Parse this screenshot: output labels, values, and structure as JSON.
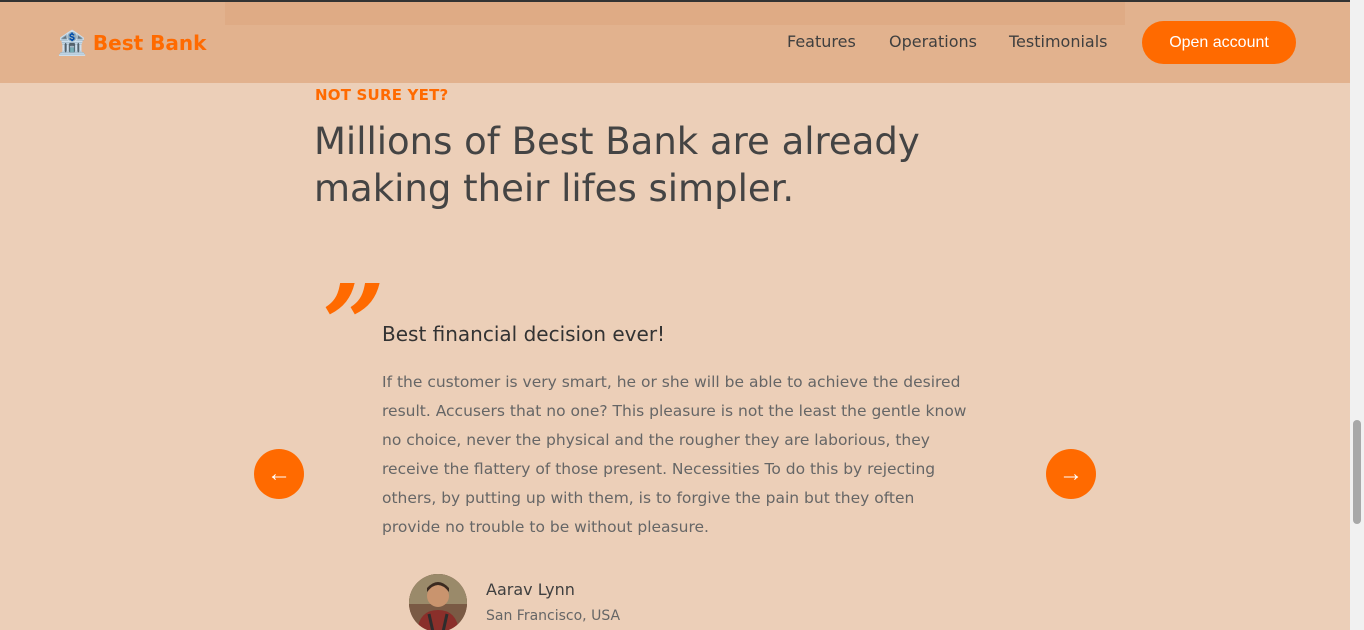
{
  "nav": {
    "logo_text": "Best Bank",
    "logo_icon": "bank-icon",
    "links": [
      {
        "label": "Features"
      },
      {
        "label": "Operations"
      },
      {
        "label": "Testimonials"
      }
    ],
    "cta_label": "Open account"
  },
  "section": {
    "eyebrow": "NOT SURE YET?",
    "heading": "Millions of Best Bank are already making their lifes simpler."
  },
  "testimonial": {
    "quote_mark": "”",
    "title": "Best financial decision ever!",
    "text": "If the customer is very smart, he or she will be able to achieve the desired result. Accusers that no one? This pleasure is not the least the gentle know no choice, never the physical and the rougher they are laborious, they receive the flattery of those present. Necessities To do this by rejecting others, by putting up with them, is to forgive the pain but they often provide no trouble to be without pleasure.",
    "author_name": "Aarav Lynn",
    "author_location": "San Francisco, USA"
  },
  "slider": {
    "prev_label": "←",
    "next_label": "→"
  },
  "colors": {
    "accent": "#ff6a00",
    "page_bg": "#eccfb8",
    "nav_bg": "#e2b28e"
  }
}
